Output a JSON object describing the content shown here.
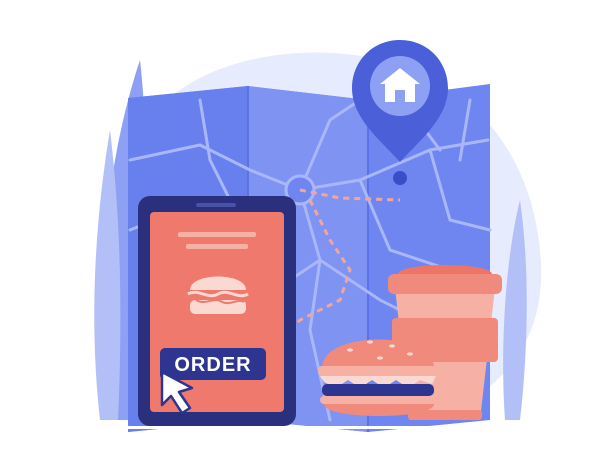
{
  "scene": {
    "description_free": true,
    "phone": {
      "order_button_label": "ORDER"
    },
    "colors": {
      "map_blue": "#6f86f0",
      "map_blue_dark": "#4f66d8",
      "backdrop": "#e6ebfd",
      "phone_dark": "#2a2f7e",
      "phone_screen": "#f0796e",
      "coral": "#f08a7c",
      "coral_light": "#f6b0a4",
      "button_dark": "#2d3590",
      "route": "#f2a69a",
      "pin": "#4a5fd8"
    },
    "icons": [
      "map-pin-icon",
      "house-icon",
      "burger-icon",
      "cursor-icon",
      "coffee-cup-icon"
    ]
  }
}
